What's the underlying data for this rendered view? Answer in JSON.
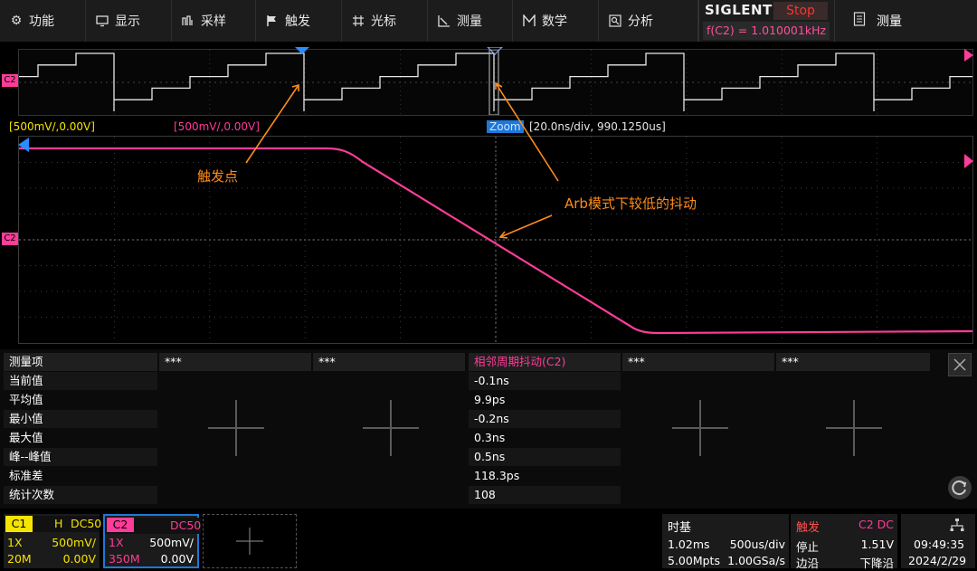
{
  "menu": {
    "items": [
      {
        "label": "功能",
        "icon": "gear-icon"
      },
      {
        "label": "显示",
        "icon": "monitor-icon"
      },
      {
        "label": "采样",
        "icon": "acquire-icon"
      },
      {
        "label": "触发",
        "icon": "flag-icon"
      },
      {
        "label": "光标",
        "icon": "cursor-icon"
      },
      {
        "label": "测量",
        "icon": "measure-icon"
      },
      {
        "label": "数学",
        "icon": "math-icon"
      },
      {
        "label": "分析",
        "icon": "analysis-icon"
      }
    ],
    "brand": "SIGLENT",
    "run_state": "Stop",
    "freq_readout": "f(C2) = 1.010001kHz",
    "right_button": {
      "label": "测量",
      "icon": "list-icon"
    }
  },
  "waveform": {
    "c1_scale": "[500mV/,0.00V]",
    "c2_scale": "[500mV/,0.00V]",
    "zoom_label": "Zoom",
    "zoom_timebase": "[20.0ns/div, 990.1250us]",
    "c2_marker": "C2",
    "annotations": {
      "trigger_point": "触发点",
      "arb_jitter": "Arb模式下较低的抖动"
    },
    "colors": {
      "c1": "#f5e400",
      "c2": "#ff3c9a",
      "annotation": "#ff8c1a",
      "zoom_bg": "#1e78d8"
    }
  },
  "measure": {
    "column_headers": [
      "测量项",
      "***",
      "***",
      "相邻周期抖动(C2)",
      "***",
      "***"
    ],
    "row_labels": [
      "当前值",
      "平均值",
      "最小值",
      "最大值",
      "峰--峰值",
      "标准差",
      "统计次数"
    ],
    "values": [
      "-0.1ns",
      "9.9ps",
      "-0.2ns",
      "0.3ns",
      "0.5ns",
      "118.3ps",
      "108"
    ]
  },
  "status": {
    "c1": {
      "name": "C1",
      "mode": "H",
      "coupling": "DC50",
      "probe": "1X",
      "scale": "500mV/",
      "bw": "20M",
      "offset": "0.00V"
    },
    "c2": {
      "name": "C2",
      "coupling": "DC50",
      "probe": "1X",
      "scale": "500mV/",
      "bw": "350M",
      "offset": "0.00V"
    },
    "timebase": {
      "title": "时基",
      "delay": "1.02ms",
      "scale": "500us/div",
      "mpts": "5.00Mpts",
      "rate": "1.00GSa/s"
    },
    "trigger": {
      "title": "触发",
      "source": "C2 DC",
      "mode": "停止",
      "level": "1.51V",
      "type": "边沿",
      "slope": "下降沿"
    },
    "clock": {
      "time": "09:49:35",
      "date": "2024/2/29"
    }
  }
}
